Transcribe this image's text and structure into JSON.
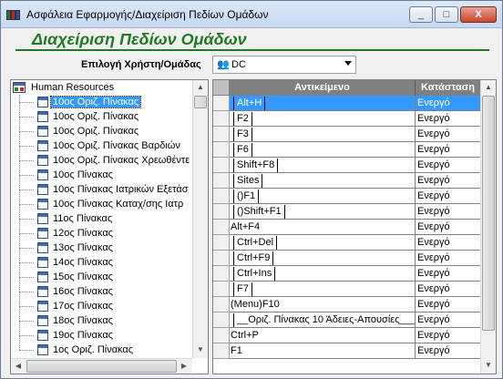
{
  "window": {
    "title": "Ασφάλεια Εφαρμογής/Διαχείριση Πεδίων Ομάδων",
    "minimize_label": "_",
    "maximize_label": "□",
    "close_label": "X"
  },
  "header": {
    "title": "Διαχείριση Πεδίων Ομάδων"
  },
  "user_select": {
    "label": "Επιλογή Χρήστη/Ομάδας",
    "value": "DC"
  },
  "tree": {
    "root_label": "Human Resources",
    "items": [
      {
        "label": "10ος Οριζ. Πίνακας",
        "selected": true
      },
      {
        "label": "10ος Οριζ. Πίνακας"
      },
      {
        "label": "10ος Οριζ. Πίνακας"
      },
      {
        "label": "10ος Οριζ. Πίνακας Βαρδιών"
      },
      {
        "label": "10ος Οριζ. Πίνακας Χρεωθέντε"
      },
      {
        "label": "10ος Πίνακας"
      },
      {
        "label": "10ος Πίνακας Ιατρικών Εξετάσ"
      },
      {
        "label": "10ος Πίνακας Καταχ/σης Ιατρ"
      },
      {
        "label": "11ος Πίνακας"
      },
      {
        "label": "12ος Πίνακας"
      },
      {
        "label": "13ος Πίνακας"
      },
      {
        "label": "14ος Πίνακας"
      },
      {
        "label": "15ος Πίνακας"
      },
      {
        "label": "16ος Πίνακας"
      },
      {
        "label": "17ος Πίνακας"
      },
      {
        "label": "18ος Πίνακας"
      },
      {
        "label": "19ος Πίνακας"
      },
      {
        "label": "1ος Οριζ. Πίνακας"
      }
    ]
  },
  "grid": {
    "columns": [
      "Αντικείμενο",
      "Κατάσταση"
    ],
    "rows": [
      {
        "object": "Alt+H",
        "status": "Ενεργό",
        "selected": true,
        "boxed": true
      },
      {
        "object": "F2",
        "status": "Ενεργό",
        "boxed": true
      },
      {
        "object": "F3",
        "status": "Ενεργό",
        "boxed": true
      },
      {
        "object": "F6",
        "status": "Ενεργό",
        "boxed": true
      },
      {
        "object": "Shift+F8",
        "status": "Ενεργό",
        "boxed": true
      },
      {
        "object": "Sites",
        "status": "Ενεργό",
        "boxed": true
      },
      {
        "object": "()F1",
        "status": "Ενεργό",
        "boxed": true
      },
      {
        "object": "()Shift+F1",
        "status": "Ενεργό",
        "boxed": true
      },
      {
        "object": "Alt+F4",
        "status": "Ενεργό",
        "boxed": false
      },
      {
        "object": "Ctrl+Del",
        "status": "Ενεργό",
        "boxed": true
      },
      {
        "object": "Ctrl+F9",
        "status": "Ενεργό",
        "boxed": true
      },
      {
        "object": "Ctrl+Ins",
        "status": "Ενεργό",
        "boxed": true
      },
      {
        "object": "F7",
        "status": "Ενεργό",
        "boxed": true
      },
      {
        "object": "(Menu)F10",
        "status": "Ενεργό",
        "boxed": false
      },
      {
        "object": "__Οριζ. Πίνακας 10 Άδειες-Απουσίες____",
        "status": "Ενεργό",
        "boxed": true
      },
      {
        "object": "Ctrl+P",
        "status": "Ενεργό",
        "boxed": false
      },
      {
        "object": "F1",
        "status": "Ενεργό",
        "boxed": false
      }
    ]
  }
}
